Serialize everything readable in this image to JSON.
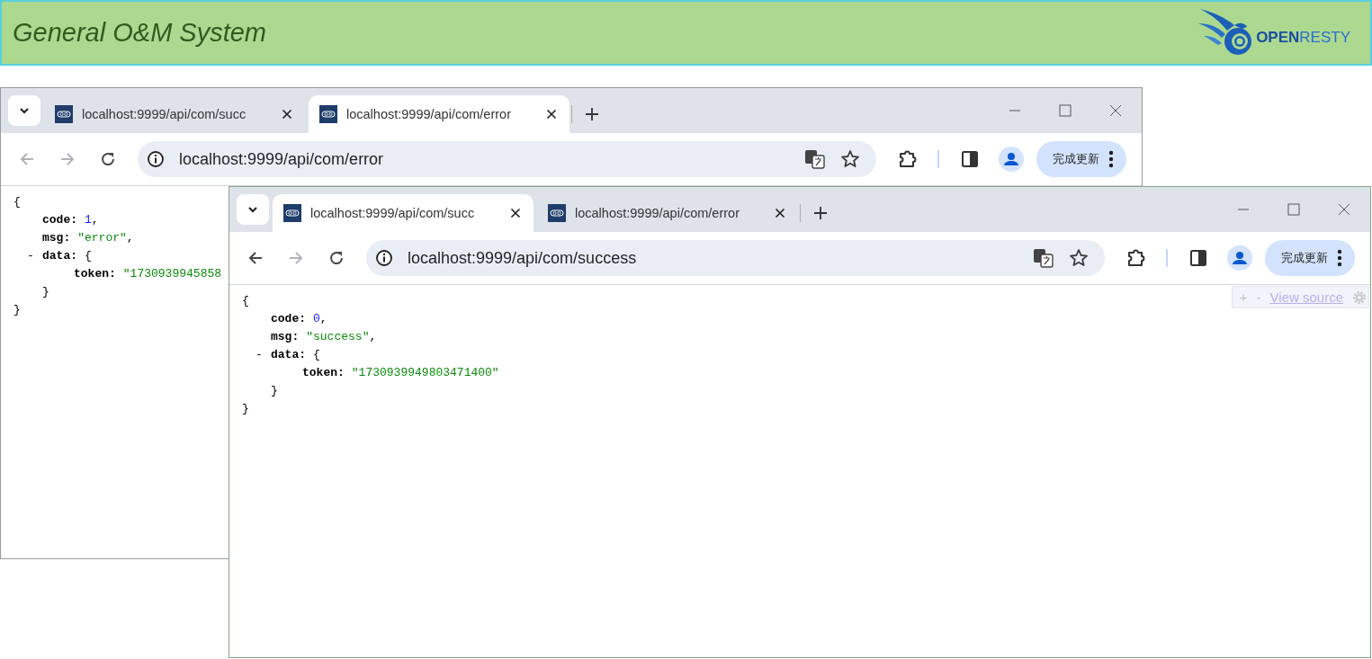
{
  "header": {
    "title": "General O&M System",
    "logo_text": "**OPEN**RESTY"
  },
  "windows": [
    {
      "tabs": [
        {
          "title": "localhost:9999/api/com/succ",
          "selected": false
        },
        {
          "title": "localhost:9999/api/com/error",
          "selected": true
        }
      ],
      "back": {
        "disabled": true
      },
      "forward": {
        "disabled": true
      },
      "url": "localhost:9999/api/com/error",
      "update_button": "完成更新",
      "document": {
        "open": "{",
        "members": [
          {
            "key": "code:",
            "kind": "number",
            "value": "1",
            "suffix": ","
          },
          {
            "key": "msg:",
            "kind": "string",
            "value": "\"error\"",
            "suffix": ","
          },
          {
            "toggle": "-",
            "key": "data:",
            "kind": "object",
            "value": "{",
            "children": [
              {
                "key": "token:",
                "kind": "string",
                "value": "\"1730939945858"
              }
            ],
            "close": "}"
          }
        ],
        "close": "}"
      }
    },
    {
      "tabs": [
        {
          "title": "localhost:9999/api/com/succ",
          "selected": true
        },
        {
          "title": "localhost:9999/api/com/error",
          "selected": false
        }
      ],
      "back": {
        "disabled": false
      },
      "forward": {
        "disabled": true
      },
      "url": "localhost:9999/api/com/success",
      "update_button": "完成更新",
      "viewer_toolbar": {
        "expand": "+",
        "collapse": "-",
        "link": "View source"
      },
      "document": {
        "open": "{",
        "members": [
          {
            "key": "code:",
            "kind": "number",
            "value": "0",
            "suffix": ","
          },
          {
            "key": "msg:",
            "kind": "string",
            "value": "\"success\"",
            "suffix": ","
          },
          {
            "toggle": "-",
            "key": "data:",
            "kind": "object",
            "value": "{",
            "children": [
              {
                "key": "token:",
                "kind": "string",
                "value": "\"1730939949803471400\""
              }
            ],
            "close": "}"
          }
        ],
        "close": "}"
      }
    }
  ]
}
